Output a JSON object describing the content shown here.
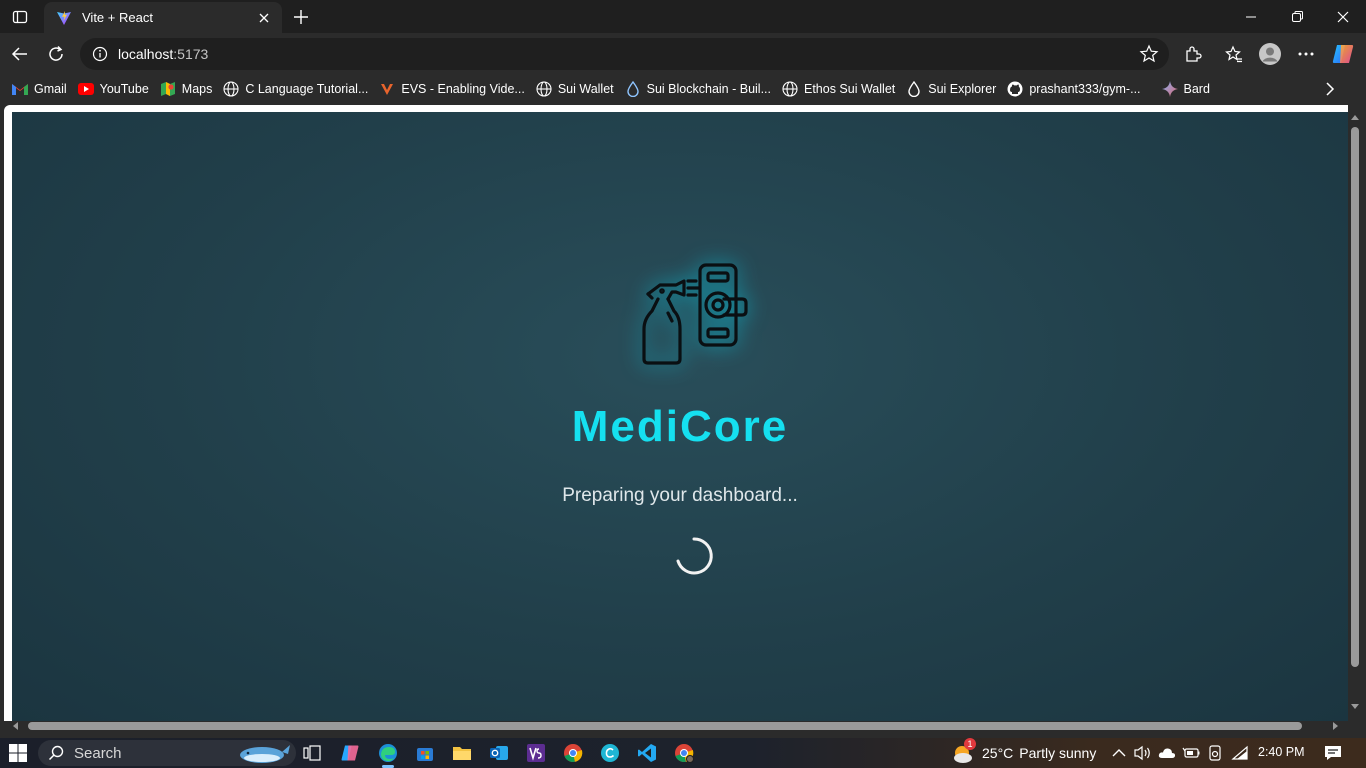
{
  "browser": {
    "tab": {
      "title": "Vite + React"
    },
    "address": {
      "host": "localhost",
      "port": ":5173"
    },
    "bookmarks": [
      {
        "label": "Gmail",
        "icon": "gmail-icon"
      },
      {
        "label": "YouTube",
        "icon": "youtube-icon"
      },
      {
        "label": "Maps",
        "icon": "maps-icon"
      },
      {
        "label": "C Language Tutorial...",
        "icon": "globe-icon"
      },
      {
        "label": "EVS - Enabling Vide...",
        "icon": "evs-icon"
      },
      {
        "label": "Sui Wallet",
        "icon": "globe-icon"
      },
      {
        "label": "Sui Blockchain - Buil...",
        "icon": "sui-drop-icon"
      },
      {
        "label": "Ethos Sui Wallet",
        "icon": "globe-icon"
      },
      {
        "label": "Sui Explorer",
        "icon": "sui-drop-icon"
      },
      {
        "label": "prashant333/gym-...",
        "icon": "github-icon"
      },
      {
        "label": "Bard",
        "icon": "bard-sparkle-icon"
      }
    ]
  },
  "page": {
    "brand": "MediCore",
    "status": "Preparing your dashboard...",
    "colors": {
      "brand": "#15e0f0",
      "background": "#213f4a"
    }
  },
  "taskbar": {
    "search_label": "Search",
    "weather": {
      "temp": "25°C",
      "condition": "Partly sunny",
      "badge": "1"
    },
    "clock": "2:40 PM"
  }
}
